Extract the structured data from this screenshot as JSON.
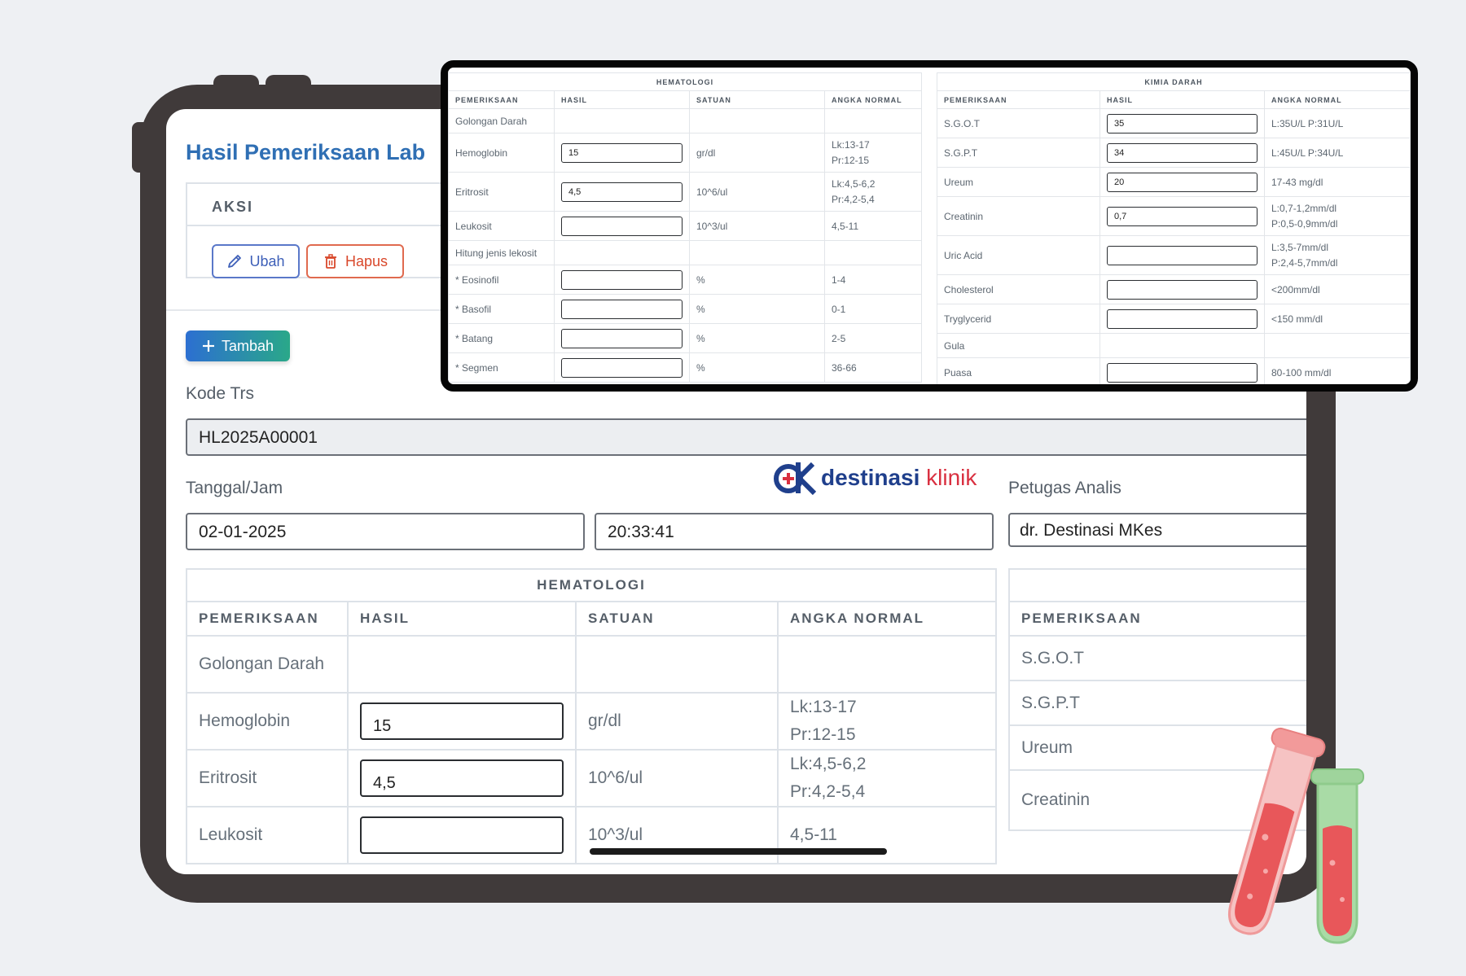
{
  "app": {
    "title": "Hasil Pemeriksaan Lab",
    "aksi_header": "AKSI",
    "ubah_label": "Ubah",
    "hapus_label": "Hapus",
    "tambah_label": "Tambah"
  },
  "form": {
    "kode_label": "Kode Trs",
    "kode_value": "HL2025A00001",
    "tanggal_label": "Tanggal/Jam",
    "tanggal_value": "02-01-2025",
    "jam_value": "20:33:41",
    "petugas_label": "Petugas Analis",
    "petugas_value": "dr. Destinasi MKes"
  },
  "logo": {
    "part1": "destinasi",
    "part2": "klinik"
  },
  "hematologi": {
    "caption": "HEMATOLOGI",
    "headers": [
      "PEMERIKSAAN",
      "HASIL",
      "SATUAN",
      "ANGKA NORMAL"
    ],
    "rows": [
      {
        "name": "Golongan Darah",
        "hasil": "",
        "satuan": "",
        "normal1": "",
        "normal2": "",
        "has_input": false
      },
      {
        "name": "Hemoglobin",
        "hasil": "15",
        "satuan": "gr/dl",
        "normal1": "Lk:13-17",
        "normal2": "Pr:12-15",
        "has_input": true
      },
      {
        "name": "Eritrosit",
        "hasil": "4,5",
        "satuan": "10^6/ul",
        "normal1": "Lk:4,5-6,2",
        "normal2": "Pr:4,2-5,4",
        "has_input": true
      },
      {
        "name": "Leukosit",
        "hasil": "",
        "satuan": "10^3/ul",
        "normal1": "4,5-11",
        "normal2": "",
        "has_input": true
      },
      {
        "name": "Hitung jenis lekosit",
        "hasil": "",
        "satuan": "",
        "normal1": "",
        "normal2": "",
        "has_input": false
      },
      {
        "name": "* Eosinofil",
        "hasil": "",
        "satuan": "%",
        "normal1": "1-4",
        "normal2": "",
        "has_input": true
      },
      {
        "name": "* Basofil",
        "hasil": "",
        "satuan": "%",
        "normal1": "0-1",
        "normal2": "",
        "has_input": true
      },
      {
        "name": "* Batang",
        "hasil": "",
        "satuan": "%",
        "normal1": "2-5",
        "normal2": "",
        "has_input": true
      },
      {
        "name": "* Segmen",
        "hasil": "",
        "satuan": "%",
        "normal1": "36-66",
        "normal2": "",
        "has_input": true
      }
    ]
  },
  "kimia": {
    "caption": "KIMIA DARAH",
    "headers": [
      "PEMERIKSAAN",
      "HASIL",
      "ANGKA NORMAL"
    ],
    "rows": [
      {
        "name": "S.G.O.T",
        "hasil": "35",
        "normal1": "L:35U/L P:31U/L",
        "normal2": "",
        "has_input": true
      },
      {
        "name": "S.G.P.T",
        "hasil": "34",
        "normal1": "L:45U/L P:34U/L",
        "normal2": "",
        "has_input": true
      },
      {
        "name": "Ureum",
        "hasil": "20",
        "normal1": "17-43 mg/dl",
        "normal2": "",
        "has_input": true
      },
      {
        "name": "Creatinin",
        "hasil": "0,7",
        "normal1": "L:0,7-1,2mm/dl",
        "normal2": "P:0,5-0,9mm/dl",
        "has_input": true
      },
      {
        "name": "Uric Acid",
        "hasil": "",
        "normal1": "L:3,5-7mm/dl",
        "normal2": "P:2,4-5,7mm/dl",
        "has_input": true
      },
      {
        "name": "Cholesterol",
        "hasil": "",
        "normal1": "<200mm/dl",
        "normal2": "",
        "has_input": true
      },
      {
        "name": "Tryglycerid",
        "hasil": "",
        "normal1": "<150 mm/dl",
        "normal2": "",
        "has_input": true
      },
      {
        "name": "Gula",
        "hasil": "",
        "normal1": "",
        "normal2": "",
        "has_input": false
      },
      {
        "name": "Puasa",
        "hasil": "",
        "normal1": "80-100 mm/dl",
        "normal2": "",
        "has_input": true
      }
    ]
  },
  "colors": {
    "accent": "#2f6fb4",
    "danger": "#d9482b",
    "frame": "#403a3a"
  },
  "icons": {
    "ubah": "pencil-icon",
    "hapus": "trash-icon",
    "tambah": "plus-icon"
  }
}
